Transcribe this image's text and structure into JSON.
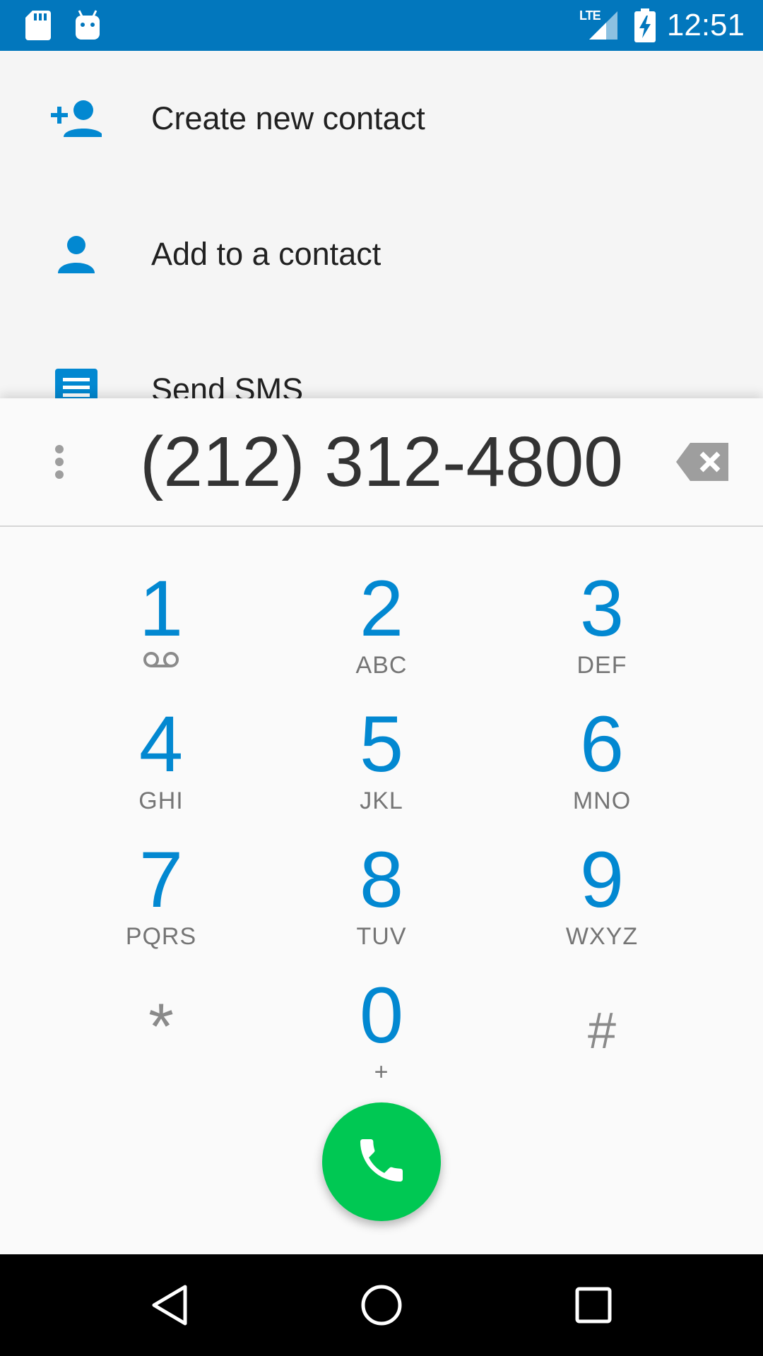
{
  "status_bar": {
    "time": "12:51",
    "network": "LTE",
    "icons": [
      "sd-card-icon",
      "android-debug-icon",
      "lte-signal-icon",
      "battery-charging-icon"
    ]
  },
  "suggestions": [
    {
      "icon": "person-add-icon",
      "label": "Create new contact"
    },
    {
      "icon": "person-icon",
      "label": "Add to a contact"
    },
    {
      "icon": "message-icon",
      "label": "Send SMS"
    }
  ],
  "dialer": {
    "number": "(212) 312-4800",
    "keys": [
      {
        "digit": "1",
        "letters": ""
      },
      {
        "digit": "2",
        "letters": "ABC"
      },
      {
        "digit": "3",
        "letters": "DEF"
      },
      {
        "digit": "4",
        "letters": "GHI"
      },
      {
        "digit": "5",
        "letters": "JKL"
      },
      {
        "digit": "6",
        "letters": "MNO"
      },
      {
        "digit": "7",
        "letters": "PQRS"
      },
      {
        "digit": "8",
        "letters": "TUV"
      },
      {
        "digit": "9",
        "letters": "WXYZ"
      },
      {
        "digit": "*",
        "letters": ""
      },
      {
        "digit": "0",
        "letters": "+"
      },
      {
        "digit": "#",
        "letters": ""
      }
    ]
  },
  "colors": {
    "status_bar": "#0277bd",
    "accent": "#0288d1",
    "call_button": "#00c853",
    "text_primary": "#212121",
    "text_secondary": "#757575"
  }
}
